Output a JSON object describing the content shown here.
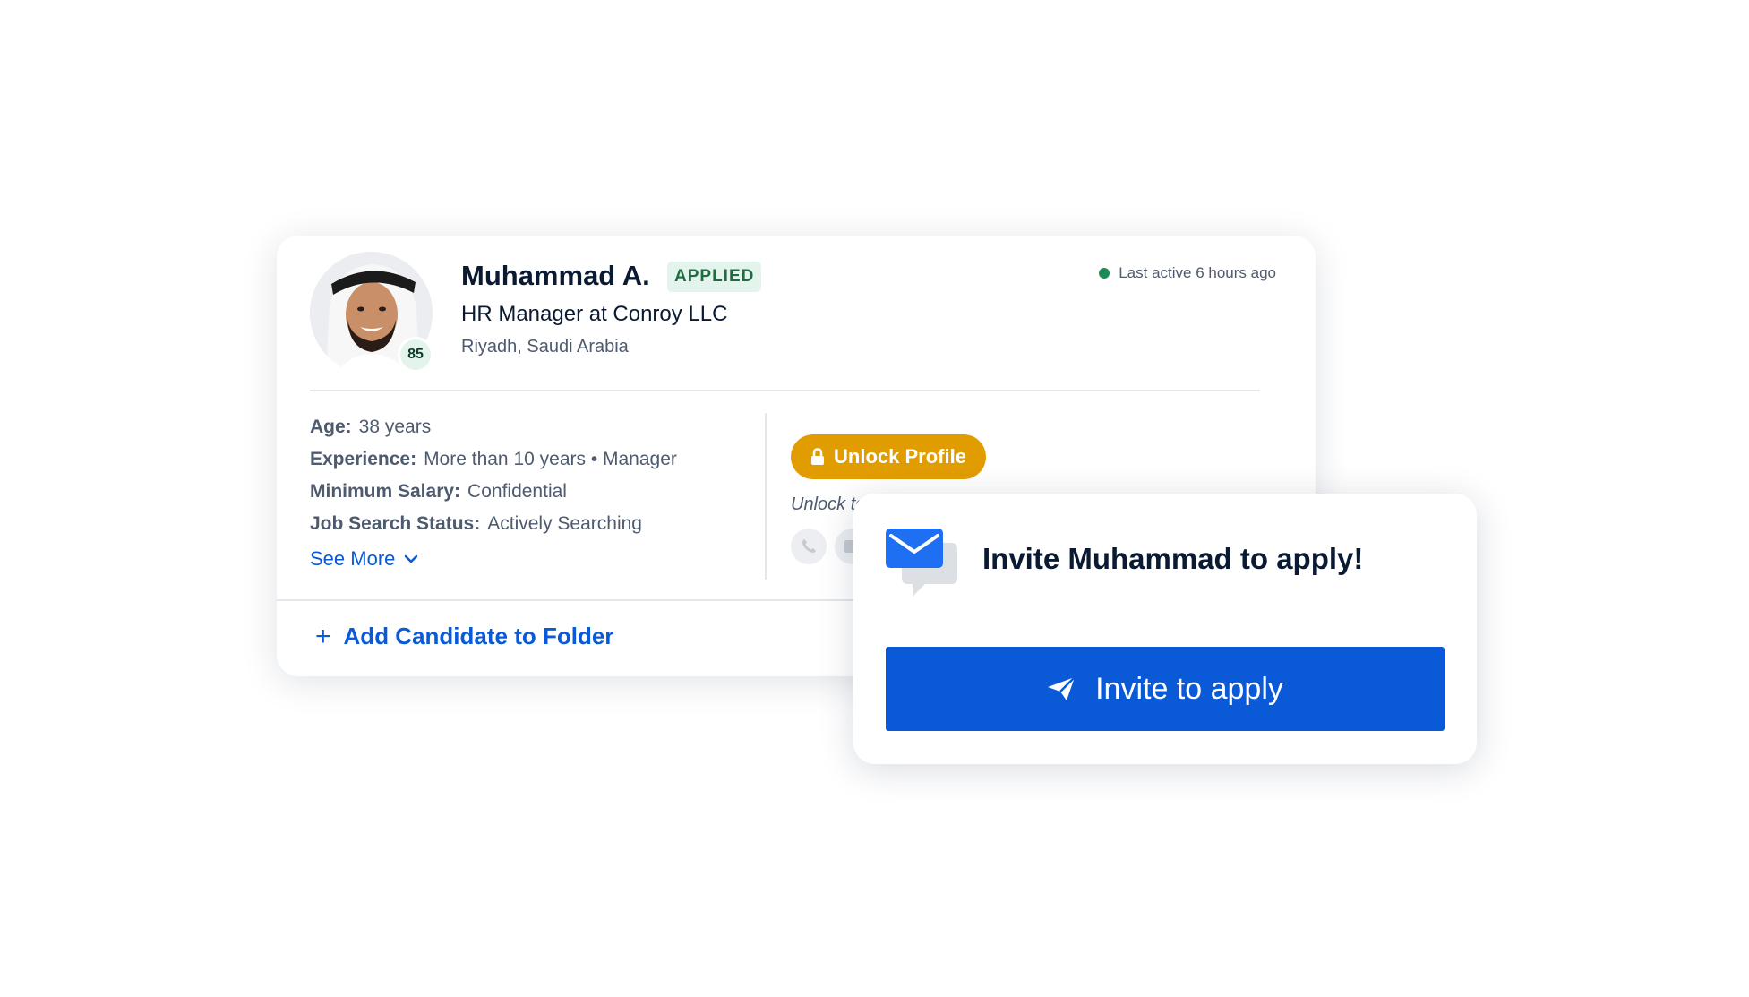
{
  "candidate": {
    "name": "Muhammad A.",
    "status_badge": "APPLIED",
    "job_title": "HR Manager at Conroy LLC",
    "location": "Riyadh, Saudi Arabia",
    "match_score": "85",
    "last_active": "Last active 6 hours ago",
    "details": [
      {
        "label": "Age:",
        "value": "38 years"
      },
      {
        "label": "Experience:",
        "value": "More than 10 years • Manager"
      },
      {
        "label": "Minimum Salary:",
        "value": "Confidential"
      },
      {
        "label": "Job Search Status:",
        "value": "Actively Searching"
      }
    ],
    "see_more_label": "See More",
    "unlock_button_label": "Unlock Profile",
    "unlock_note": "Unlock to",
    "add_to_folder_label": "Add Candidate to Folder"
  },
  "invite": {
    "heading": "Invite Muhammad to apply!",
    "button_label": "Invite to apply"
  },
  "colors": {
    "primary_blue": "#0a5ad8",
    "unlock_amber": "#e19d00",
    "applied_green": "#1f6b42",
    "online_dot": "#1f8a57"
  },
  "icons": [
    "avatar-photo",
    "online-status-dot",
    "lock-icon",
    "chevron-down-icon",
    "phone-icon",
    "email-icon",
    "plus-icon",
    "envelope-chat-icon",
    "paper-plane-icon"
  ]
}
